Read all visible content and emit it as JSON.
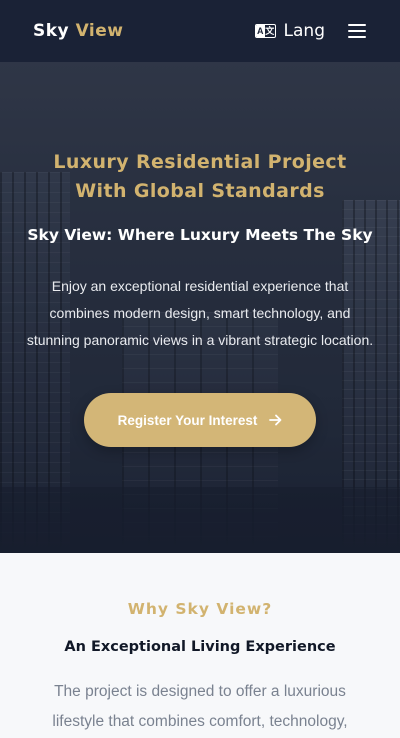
{
  "header": {
    "logo_primary": "Sky",
    "logo_accent": "View",
    "lang_label": "Lang",
    "lang_icon": "translate-icon",
    "menu_icon": "hamburger-menu-icon"
  },
  "hero": {
    "eyebrow": "Luxury Residential Project With Global Standards",
    "headline": "Sky View: Where Luxury Meets The Sky",
    "description": "Enjoy an exceptional residential experience that combines modern design, smart technology, and stunning panoramic views in a vibrant strategic location.",
    "cta_label": "Register Your Interest",
    "cta_icon": "arrow-right-icon"
  },
  "why": {
    "label": "Why Sky View?",
    "subtitle": "An Exceptional Living Experience",
    "text": "The project is designed to offer a luxurious lifestyle that combines comfort, technology,"
  },
  "colors": {
    "header_bg": "#1a2236",
    "accent_gold": "#d2b36f",
    "cta_bg": "#d3b677",
    "section_bg": "#f7f8fa",
    "body_text_gray": "#7a8290"
  }
}
